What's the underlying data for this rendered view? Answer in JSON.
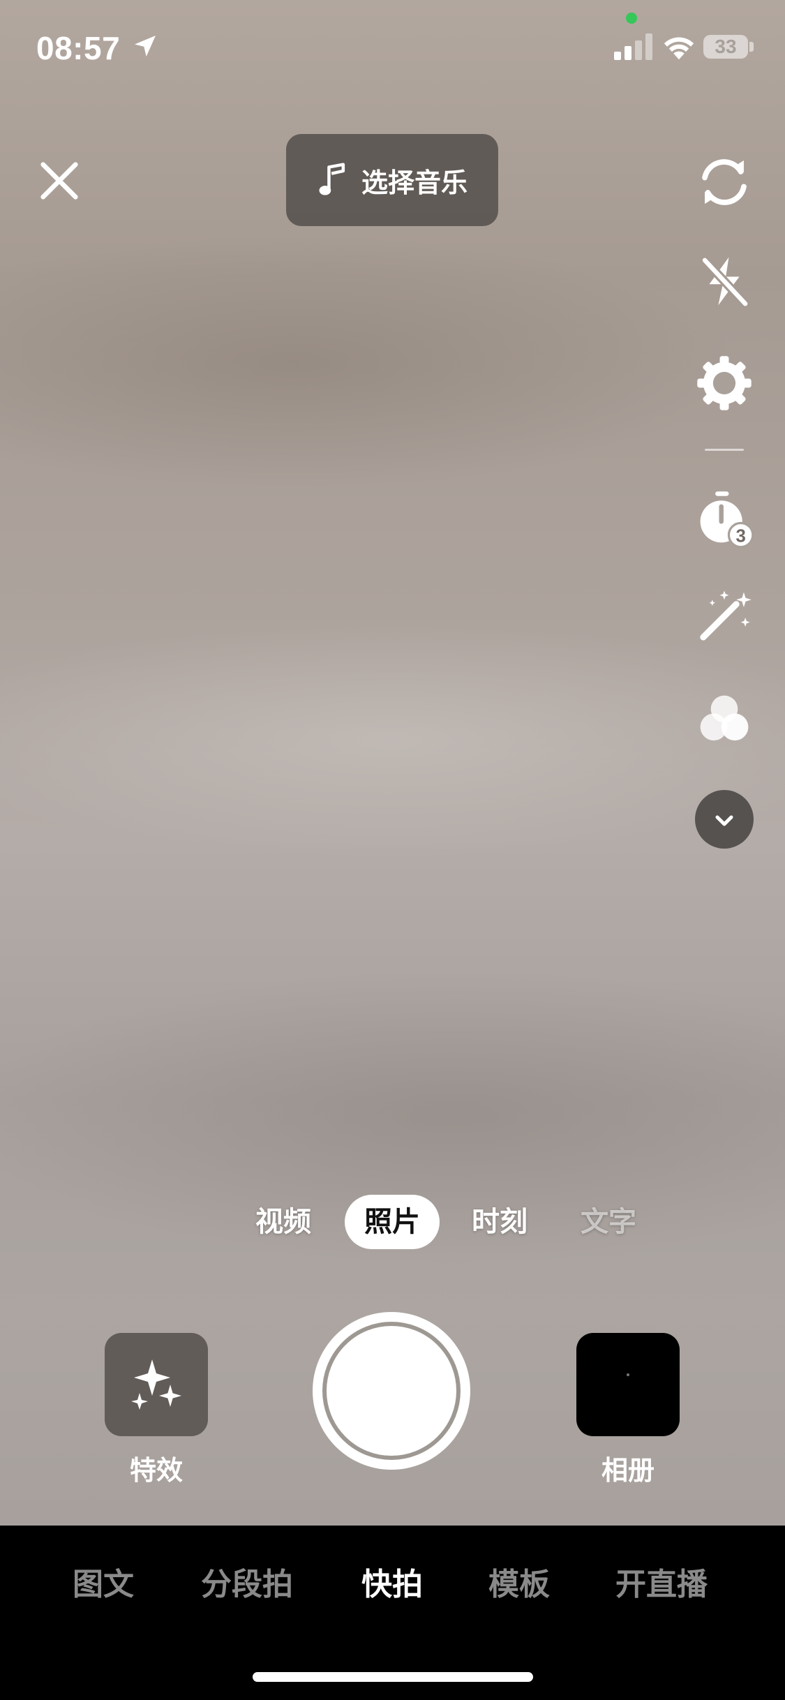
{
  "status_bar": {
    "time": "08:57",
    "battery": "33",
    "icons": [
      "location-arrow-icon",
      "signal-icon",
      "wifi-icon",
      "battery-icon"
    ]
  },
  "top_bar": {
    "music_label": "选择音乐",
    "icons": [
      "close-icon",
      "music-note-icon"
    ]
  },
  "side_toolbar": {
    "icons": [
      "flip-camera-icon",
      "flash-off-icon",
      "settings-gear-icon",
      "timer-icon",
      "beauty-wand-icon",
      "filter-icon",
      "chevron-down-icon"
    ],
    "timer_badge": "3"
  },
  "capture_modes": {
    "items": [
      "视频",
      "照片",
      "时刻",
      "文字"
    ],
    "selected": "照片"
  },
  "controls": {
    "effects_label": "特效",
    "album_label": "相册"
  },
  "bottom_nav": {
    "items": [
      "图文",
      "分段拍",
      "快拍",
      "模板",
      "开直播"
    ],
    "selected": "快拍"
  },
  "colors": {
    "camera_bg": "#a9a09a",
    "active_pill": "#ffffff",
    "nav_inactive": "#8a8a8a",
    "privacy_dot": "#35c759"
  }
}
